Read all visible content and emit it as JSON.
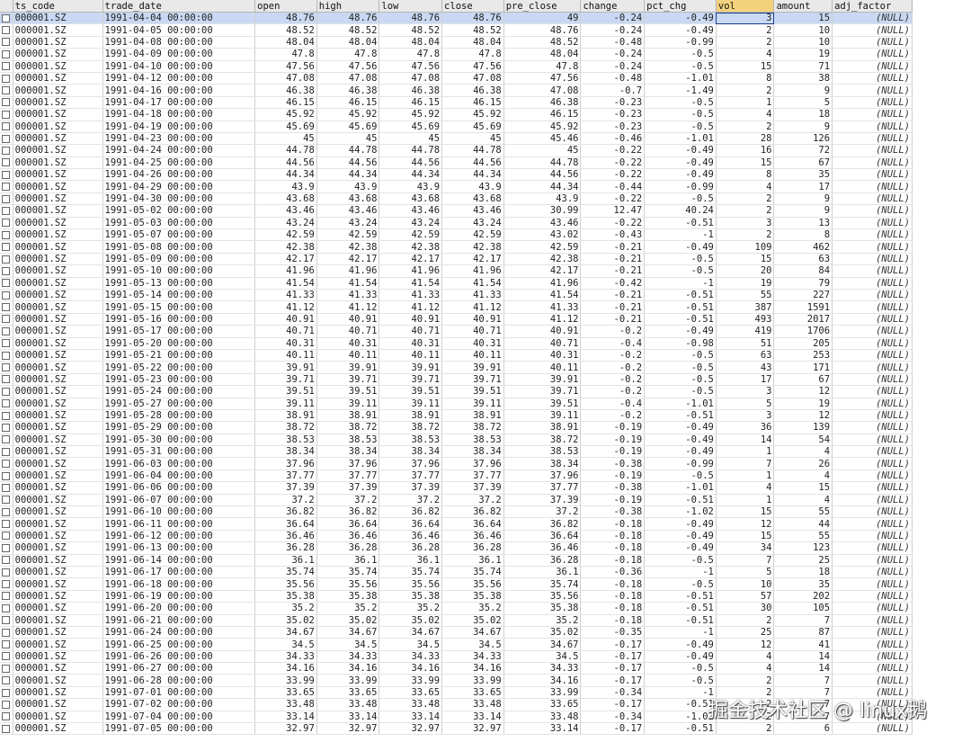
{
  "columns": [
    "ts_code",
    "trade_date",
    "open",
    "high",
    "low",
    "close",
    "pre_close",
    "change",
    "pct_chg",
    "vol",
    "amount",
    "adj_factor"
  ],
  "selected_column": "vol",
  "rows": [
    [
      "000001.SZ",
      "1991-04-04 00:00:00",
      "48.76",
      "48.76",
      "48.76",
      "48.76",
      "49",
      "-0.24",
      "-0.49",
      "3",
      "15",
      "(NULL)"
    ],
    [
      "000001.SZ",
      "1991-04-05 00:00:00",
      "48.52",
      "48.52",
      "48.52",
      "48.52",
      "48.76",
      "-0.24",
      "-0.49",
      "2",
      "10",
      "(NULL)"
    ],
    [
      "000001.SZ",
      "1991-04-08 00:00:00",
      "48.04",
      "48.04",
      "48.04",
      "48.04",
      "48.52",
      "-0.48",
      "-0.99",
      "2",
      "10",
      "(NULL)"
    ],
    [
      "000001.SZ",
      "1991-04-09 00:00:00",
      "47.8",
      "47.8",
      "47.8",
      "47.8",
      "48.04",
      "-0.24",
      "-0.5",
      "4",
      "19",
      "(NULL)"
    ],
    [
      "000001.SZ",
      "1991-04-10 00:00:00",
      "47.56",
      "47.56",
      "47.56",
      "47.56",
      "47.8",
      "-0.24",
      "-0.5",
      "15",
      "71",
      "(NULL)"
    ],
    [
      "000001.SZ",
      "1991-04-12 00:00:00",
      "47.08",
      "47.08",
      "47.08",
      "47.08",
      "47.56",
      "-0.48",
      "-1.01",
      "8",
      "38",
      "(NULL)"
    ],
    [
      "000001.SZ",
      "1991-04-16 00:00:00",
      "46.38",
      "46.38",
      "46.38",
      "46.38",
      "47.08",
      "-0.7",
      "-1.49",
      "2",
      "9",
      "(NULL)"
    ],
    [
      "000001.SZ",
      "1991-04-17 00:00:00",
      "46.15",
      "46.15",
      "46.15",
      "46.15",
      "46.38",
      "-0.23",
      "-0.5",
      "1",
      "5",
      "(NULL)"
    ],
    [
      "000001.SZ",
      "1991-04-18 00:00:00",
      "45.92",
      "45.92",
      "45.92",
      "45.92",
      "46.15",
      "-0.23",
      "-0.5",
      "4",
      "18",
      "(NULL)"
    ],
    [
      "000001.SZ",
      "1991-04-19 00:00:00",
      "45.69",
      "45.69",
      "45.69",
      "45.69",
      "45.92",
      "-0.23",
      "-0.5",
      "2",
      "9",
      "(NULL)"
    ],
    [
      "000001.SZ",
      "1991-04-23 00:00:00",
      "45",
      "45",
      "45",
      "45",
      "45.46",
      "-0.46",
      "-1.01",
      "28",
      "126",
      "(NULL)"
    ],
    [
      "000001.SZ",
      "1991-04-24 00:00:00",
      "44.78",
      "44.78",
      "44.78",
      "44.78",
      "45",
      "-0.22",
      "-0.49",
      "16",
      "72",
      "(NULL)"
    ],
    [
      "000001.SZ",
      "1991-04-25 00:00:00",
      "44.56",
      "44.56",
      "44.56",
      "44.56",
      "44.78",
      "-0.22",
      "-0.49",
      "15",
      "67",
      "(NULL)"
    ],
    [
      "000001.SZ",
      "1991-04-26 00:00:00",
      "44.34",
      "44.34",
      "44.34",
      "44.34",
      "44.56",
      "-0.22",
      "-0.49",
      "8",
      "35",
      "(NULL)"
    ],
    [
      "000001.SZ",
      "1991-04-29 00:00:00",
      "43.9",
      "43.9",
      "43.9",
      "43.9",
      "44.34",
      "-0.44",
      "-0.99",
      "4",
      "17",
      "(NULL)"
    ],
    [
      "000001.SZ",
      "1991-04-30 00:00:00",
      "43.68",
      "43.68",
      "43.68",
      "43.68",
      "43.9",
      "-0.22",
      "-0.5",
      "2",
      "9",
      "(NULL)"
    ],
    [
      "000001.SZ",
      "1991-05-02 00:00:00",
      "43.46",
      "43.46",
      "43.46",
      "43.46",
      "30.99",
      "12.47",
      "40.24",
      "2",
      "9",
      "(NULL)"
    ],
    [
      "000001.SZ",
      "1991-05-03 00:00:00",
      "43.24",
      "43.24",
      "43.24",
      "43.24",
      "43.46",
      "-0.22",
      "-0.51",
      "3",
      "13",
      "(NULL)"
    ],
    [
      "000001.SZ",
      "1991-05-07 00:00:00",
      "42.59",
      "42.59",
      "42.59",
      "42.59",
      "43.02",
      "-0.43",
      "-1",
      "2",
      "8",
      "(NULL)"
    ],
    [
      "000001.SZ",
      "1991-05-08 00:00:00",
      "42.38",
      "42.38",
      "42.38",
      "42.38",
      "42.59",
      "-0.21",
      "-0.49",
      "109",
      "462",
      "(NULL)"
    ],
    [
      "000001.SZ",
      "1991-05-09 00:00:00",
      "42.17",
      "42.17",
      "42.17",
      "42.17",
      "42.38",
      "-0.21",
      "-0.5",
      "15",
      "63",
      "(NULL)"
    ],
    [
      "000001.SZ",
      "1991-05-10 00:00:00",
      "41.96",
      "41.96",
      "41.96",
      "41.96",
      "42.17",
      "-0.21",
      "-0.5",
      "20",
      "84",
      "(NULL)"
    ],
    [
      "000001.SZ",
      "1991-05-13 00:00:00",
      "41.54",
      "41.54",
      "41.54",
      "41.54",
      "41.96",
      "-0.42",
      "-1",
      "19",
      "79",
      "(NULL)"
    ],
    [
      "000001.SZ",
      "1991-05-14 00:00:00",
      "41.33",
      "41.33",
      "41.33",
      "41.33",
      "41.54",
      "-0.21",
      "-0.51",
      "55",
      "227",
      "(NULL)"
    ],
    [
      "000001.SZ",
      "1991-05-15 00:00:00",
      "41.12",
      "41.12",
      "41.12",
      "41.12",
      "41.33",
      "-0.21",
      "-0.51",
      "387",
      "1591",
      "(NULL)"
    ],
    [
      "000001.SZ",
      "1991-05-16 00:00:00",
      "40.91",
      "40.91",
      "40.91",
      "40.91",
      "41.12",
      "-0.21",
      "-0.51",
      "493",
      "2017",
      "(NULL)"
    ],
    [
      "000001.SZ",
      "1991-05-17 00:00:00",
      "40.71",
      "40.71",
      "40.71",
      "40.71",
      "40.91",
      "-0.2",
      "-0.49",
      "419",
      "1706",
      "(NULL)"
    ],
    [
      "000001.SZ",
      "1991-05-20 00:00:00",
      "40.31",
      "40.31",
      "40.31",
      "40.31",
      "40.71",
      "-0.4",
      "-0.98",
      "51",
      "205",
      "(NULL)"
    ],
    [
      "000001.SZ",
      "1991-05-21 00:00:00",
      "40.11",
      "40.11",
      "40.11",
      "40.11",
      "40.31",
      "-0.2",
      "-0.5",
      "63",
      "253",
      "(NULL)"
    ],
    [
      "000001.SZ",
      "1991-05-22 00:00:00",
      "39.91",
      "39.91",
      "39.91",
      "39.91",
      "40.11",
      "-0.2",
      "-0.5",
      "43",
      "171",
      "(NULL)"
    ],
    [
      "000001.SZ",
      "1991-05-23 00:00:00",
      "39.71",
      "39.71",
      "39.71",
      "39.71",
      "39.91",
      "-0.2",
      "-0.5",
      "17",
      "67",
      "(NULL)"
    ],
    [
      "000001.SZ",
      "1991-05-24 00:00:00",
      "39.51",
      "39.51",
      "39.51",
      "39.51",
      "39.71",
      "-0.2",
      "-0.5",
      "3",
      "12",
      "(NULL)"
    ],
    [
      "000001.SZ",
      "1991-05-27 00:00:00",
      "39.11",
      "39.11",
      "39.11",
      "39.11",
      "39.51",
      "-0.4",
      "-1.01",
      "5",
      "19",
      "(NULL)"
    ],
    [
      "000001.SZ",
      "1991-05-28 00:00:00",
      "38.91",
      "38.91",
      "38.91",
      "38.91",
      "39.11",
      "-0.2",
      "-0.51",
      "3",
      "12",
      "(NULL)"
    ],
    [
      "000001.SZ",
      "1991-05-29 00:00:00",
      "38.72",
      "38.72",
      "38.72",
      "38.72",
      "38.91",
      "-0.19",
      "-0.49",
      "36",
      "139",
      "(NULL)"
    ],
    [
      "000001.SZ",
      "1991-05-30 00:00:00",
      "38.53",
      "38.53",
      "38.53",
      "38.53",
      "38.72",
      "-0.19",
      "-0.49",
      "14",
      "54",
      "(NULL)"
    ],
    [
      "000001.SZ",
      "1991-05-31 00:00:00",
      "38.34",
      "38.34",
      "38.34",
      "38.34",
      "38.53",
      "-0.19",
      "-0.49",
      "1",
      "4",
      "(NULL)"
    ],
    [
      "000001.SZ",
      "1991-06-03 00:00:00",
      "37.96",
      "37.96",
      "37.96",
      "37.96",
      "38.34",
      "-0.38",
      "-0.99",
      "7",
      "26",
      "(NULL)"
    ],
    [
      "000001.SZ",
      "1991-06-04 00:00:00",
      "37.77",
      "37.77",
      "37.77",
      "37.77",
      "37.96",
      "-0.19",
      "-0.5",
      "1",
      "4",
      "(NULL)"
    ],
    [
      "000001.SZ",
      "1991-06-06 00:00:00",
      "37.39",
      "37.39",
      "37.39",
      "37.39",
      "37.77",
      "-0.38",
      "-1.01",
      "4",
      "15",
      "(NULL)"
    ],
    [
      "000001.SZ",
      "1991-06-07 00:00:00",
      "37.2",
      "37.2",
      "37.2",
      "37.2",
      "37.39",
      "-0.19",
      "-0.51",
      "1",
      "4",
      "(NULL)"
    ],
    [
      "000001.SZ",
      "1991-06-10 00:00:00",
      "36.82",
      "36.82",
      "36.82",
      "36.82",
      "37.2",
      "-0.38",
      "-1.02",
      "15",
      "55",
      "(NULL)"
    ],
    [
      "000001.SZ",
      "1991-06-11 00:00:00",
      "36.64",
      "36.64",
      "36.64",
      "36.64",
      "36.82",
      "-0.18",
      "-0.49",
      "12",
      "44",
      "(NULL)"
    ],
    [
      "000001.SZ",
      "1991-06-12 00:00:00",
      "36.46",
      "36.46",
      "36.46",
      "36.46",
      "36.64",
      "-0.18",
      "-0.49",
      "15",
      "55",
      "(NULL)"
    ],
    [
      "000001.SZ",
      "1991-06-13 00:00:00",
      "36.28",
      "36.28",
      "36.28",
      "36.28",
      "36.46",
      "-0.18",
      "-0.49",
      "34",
      "123",
      "(NULL)"
    ],
    [
      "000001.SZ",
      "1991-06-14 00:00:00",
      "36.1",
      "36.1",
      "36.1",
      "36.1",
      "36.28",
      "-0.18",
      "-0.5",
      "7",
      "25",
      "(NULL)"
    ],
    [
      "000001.SZ",
      "1991-06-17 00:00:00",
      "35.74",
      "35.74",
      "35.74",
      "35.74",
      "36.1",
      "-0.36",
      "-1",
      "5",
      "18",
      "(NULL)"
    ],
    [
      "000001.SZ",
      "1991-06-18 00:00:00",
      "35.56",
      "35.56",
      "35.56",
      "35.56",
      "35.74",
      "-0.18",
      "-0.5",
      "10",
      "35",
      "(NULL)"
    ],
    [
      "000001.SZ",
      "1991-06-19 00:00:00",
      "35.38",
      "35.38",
      "35.38",
      "35.38",
      "35.56",
      "-0.18",
      "-0.51",
      "57",
      "202",
      "(NULL)"
    ],
    [
      "000001.SZ",
      "1991-06-20 00:00:00",
      "35.2",
      "35.2",
      "35.2",
      "35.2",
      "35.38",
      "-0.18",
      "-0.51",
      "30",
      "105",
      "(NULL)"
    ],
    [
      "000001.SZ",
      "1991-06-21 00:00:00",
      "35.02",
      "35.02",
      "35.02",
      "35.02",
      "35.2",
      "-0.18",
      "-0.51",
      "2",
      "7",
      "(NULL)"
    ],
    [
      "000001.SZ",
      "1991-06-24 00:00:00",
      "34.67",
      "34.67",
      "34.67",
      "34.67",
      "35.02",
      "-0.35",
      "-1",
      "25",
      "87",
      "(NULL)"
    ],
    [
      "000001.SZ",
      "1991-06-25 00:00:00",
      "34.5",
      "34.5",
      "34.5",
      "34.5",
      "34.67",
      "-0.17",
      "-0.49",
      "12",
      "41",
      "(NULL)"
    ],
    [
      "000001.SZ",
      "1991-06-26 00:00:00",
      "34.33",
      "34.33",
      "34.33",
      "34.33",
      "34.5",
      "-0.17",
      "-0.49",
      "4",
      "14",
      "(NULL)"
    ],
    [
      "000001.SZ",
      "1991-06-27 00:00:00",
      "34.16",
      "34.16",
      "34.16",
      "34.16",
      "34.33",
      "-0.17",
      "-0.5",
      "4",
      "14",
      "(NULL)"
    ],
    [
      "000001.SZ",
      "1991-06-28 00:00:00",
      "33.99",
      "33.99",
      "33.99",
      "33.99",
      "34.16",
      "-0.17",
      "-0.5",
      "2",
      "7",
      "(NULL)"
    ],
    [
      "000001.SZ",
      "1991-07-01 00:00:00",
      "33.65",
      "33.65",
      "33.65",
      "33.65",
      "33.99",
      "-0.34",
      "-1",
      "2",
      "7",
      "(NULL)"
    ],
    [
      "000001.SZ",
      "1991-07-02 00:00:00",
      "33.48",
      "33.48",
      "33.48",
      "33.48",
      "33.65",
      "-0.17",
      "-0.51",
      "2",
      "7",
      "(NULL)"
    ],
    [
      "000001.SZ",
      "1991-07-04 00:00:00",
      "33.14",
      "33.14",
      "33.14",
      "33.14",
      "33.48",
      "-0.34",
      "-1.02",
      "2",
      "7",
      "(NULL)"
    ],
    [
      "000001.SZ",
      "1991-07-05 00:00:00",
      "32.97",
      "32.97",
      "32.97",
      "32.97",
      "33.14",
      "-0.17",
      "-0.51",
      "2",
      "6",
      "(NULL)"
    ]
  ],
  "watermark": "掘金技术社区 @ linux鹅"
}
